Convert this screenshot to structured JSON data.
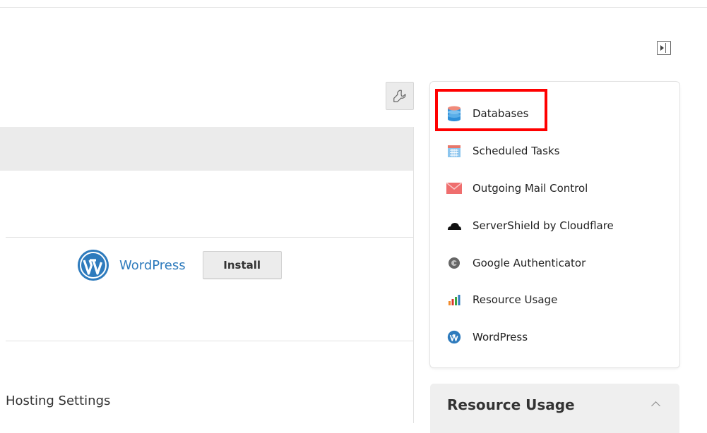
{
  "main": {
    "app_name": "WordPress",
    "install_label": "Install",
    "section_title": "Hosting Settings"
  },
  "sidebar": {
    "items": [
      {
        "label": "Databases",
        "icon": "database-icon",
        "highlighted": true
      },
      {
        "label": "Scheduled Tasks",
        "icon": "calendar-icon"
      },
      {
        "label": "Outgoing Mail Control",
        "icon": "mail-icon"
      },
      {
        "label": "ServerShield by Cloudflare",
        "icon": "cloud-icon"
      },
      {
        "label": "Google Authenticator",
        "icon": "authenticator-icon"
      },
      {
        "label": "Resource Usage",
        "icon": "bar-chart-icon"
      },
      {
        "label": "WordPress",
        "icon": "wordpress-icon"
      }
    ]
  },
  "resource_panel": {
    "title": "Resource Usage"
  },
  "colors": {
    "link": "#2e7bbd",
    "highlight": "#ff0000",
    "header_bg": "#ebebeb"
  }
}
